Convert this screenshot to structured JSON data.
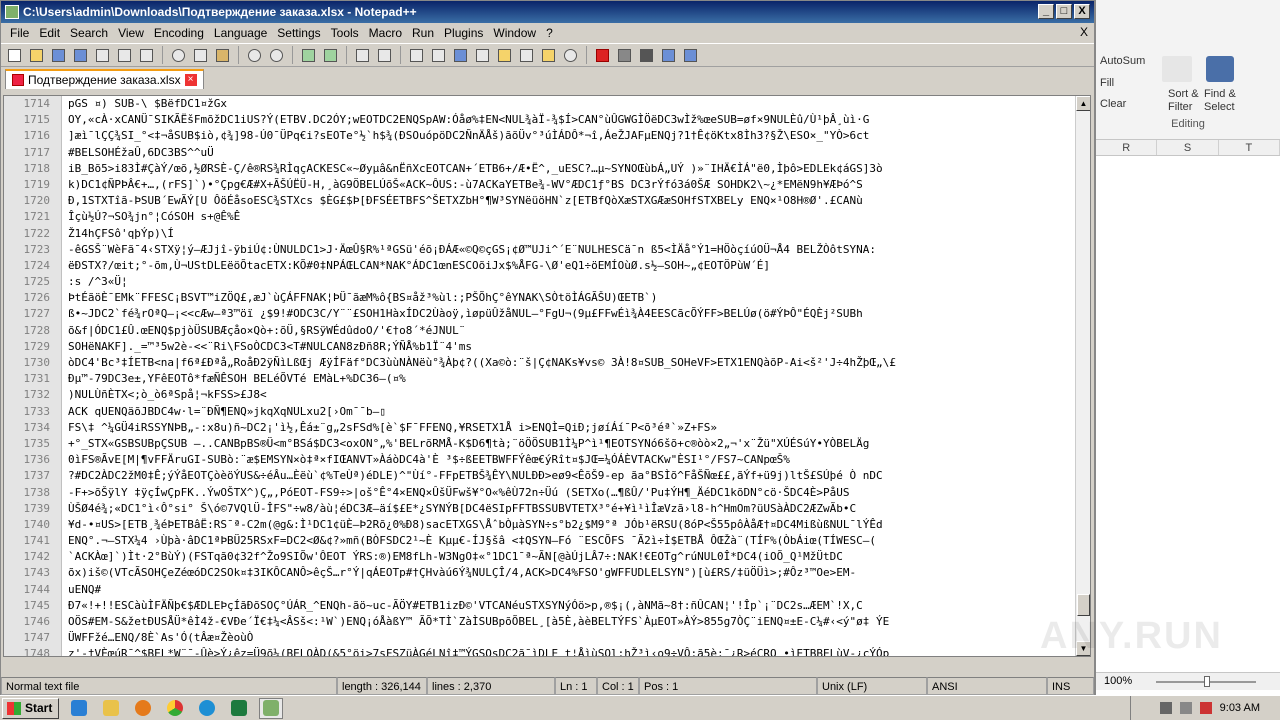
{
  "window": {
    "title": "C:\\Users\\admin\\Downloads\\Подтверждение заказа.xlsx - Notepad++",
    "min": "_",
    "max": "□",
    "close": "X"
  },
  "menu": [
    "File",
    "Edit",
    "Search",
    "View",
    "Encoding",
    "Language",
    "Settings",
    "Tools",
    "Macro",
    "Run",
    "Plugins",
    "Window",
    "?"
  ],
  "menu_close": "X",
  "tab": {
    "label": "Подтверждение заказа.xlsx",
    "close": "×"
  },
  "editor_lines": [
    {
      "n": "1714",
      "t": "pGS ¤) SUB-\\ $BëfDC1¤žGx"
    },
    {
      "n": "1715",
      "t": "OY,«cÀ·xCANÜ¯SIKÃËšFmõžDC1iUS?Ý(ETBV.DC2ÓY;wEOTDC2ENQSpAW:Óåø%‡EN<NUL¾àÏ-¾$Í>CAN°ùÛGWGÌÖëDC3wÌž%œeSUB=øf×9NULÈû/Ù¹þÂ¸ùì·G"
    },
    {
      "n": "1716",
      "t": "]æì¯lÇÇ¾SI_°<‡¬åSUB$iò,¢¾]98-Ú0¯ÜPq€i?sEOTe°½`h$¾(ÐSOuópöDC2ÑnÄÅš)ãõÜv°³úÌÁDÔ*¬î,ÁeŽJAFµENQj?1†Ê¢öKtx8Ìh3?§Ž\\ESO×_\"YÒ>6ct"
    },
    {
      "n": "1717",
      "t": "#BELSOHÉžaÛ,6DC3BS^^uÜ"
    },
    {
      "n": "1718",
      "t": "iB_Bõ5>i83Ì#ÇàÝ/œõ,½ØRSÈ-Ç/ê®RS¾RÌqçACKESC«~Øyµâ&nËñXcEOTCAN+´ETB6+/Æ•Ë^,_uESC?…µ~SYNOŒùbÁ„UÝ )»¨IHÄ€ÌÁ\"ë0,Ìþô>EDLEk¢áGS]3ò"
    },
    {
      "n": "1719",
      "t": "k)DC1¢ÑPÞÂ€+…,(rFS]`)•°Çpg€Æ#X+ÃŠÚËÜ-H,¸àG9ÖBELÚõŠ«ACK~ÔUS:-ù7ACKaYETBe¾-WV°ÆDC1ƒ°BS DC3rÝfó3á0ŠÆ SOHDK2\\~¿*EMëN9h¥ÆÞó^S"
    },
    {
      "n": "1720",
      "t": "Ð,1STXTîã-ÞSUB´EwÃÝ[U ÔöÉåsoESC¾STXcs $ÈG£$Þ[ÐFSÉETBFS^ŠETXZbH°¶W³SYNëüöHN`z[ETBfQòXæSTXGÆæSOHfSTXBELy ENQ×¹O8H®Ø'.£CANù"
    },
    {
      "n": "1721",
      "t": "Îçù½Ú?¬SO¾jn°¦CóSOH s+@Ê%Ê"
    },
    {
      "n": "1722",
      "t": "Ž14hÇFSô'qþÝp)\\Í"
    },
    {
      "n": "1723",
      "t": "-êGSŠ¨WèFã¯4‹STXÿ¦ý—ÆJjî-ÿbiÚ¢:ÙNULDC1>J·ÄœÛ§R%¹ªGSü'éõ¡ÐÁÆ«©Q©çGS¡¢Ø™UJi^´E¨NULHESCä¯n ß5<ÌÄå°Ý1=HÖòçíúOÜ¬Å4 BELŽÒôtSYNA:"
    },
    {
      "n": "1724",
      "t": "ëÐSTX?/œit;°-õm,Ù¬UStDLEëöÕtacETX:KÕ#0‡NPÁŒLCAN*NAK°ÁDC1œnESCOõiJx$%ÅFG-\\Ø'eQ1÷öEMÍOùØ.s½—SOH~„¢EOTÖPùW´É]"
    },
    {
      "n": "1725",
      "t": ":s  /^3«Ü¦"
    },
    {
      "n": "1726",
      "t": "ÞtÉãöÈ¯EMk¨FFESC¡BSVT™iZÖQ£,æJ`ùÇÁFFNAK¦ÞÜ¯ãæM%ô{BS¤åž³%ùl:;PŠÕhÇ°êYNAK\\SÒtöÌÁGÃŠU)ŒETB`)"
    },
    {
      "n": "1727",
      "t": " ß•~JDC2`fé¾rOªQ—¡<<cÆw—ª3™öï  ¿$9!#ODC3C/Y¨¨£SOH1HàxÍDC2Ùàoÿ,ìøpüÛžåNUL—°FgU¬(9µ£FFwÉì¾À4EESCãcÕÝFF>BELÚø(ö#ÝÞÔ\"ÉQÈj²SUBh"
    },
    {
      "n": "1728",
      "t": "õ&f|ÓDC1£Û.œENQ$pjòÜSUBÆçåo×Qò+:õÜ,§RSÿWÉdûdoO/'€†o8´*éJNUL¨"
    },
    {
      "n": "1729",
      "t": "SOHëNAKF]._=™³5w2è-<<¨Ri\\FSoÒCDC3<T#NULCAN8zÐñ8R;ÝÑÅ%b1Ï¨4'ms"
    },
    {
      "n": "1730",
      "t": "òDC4'Bc³‡ÍETB<na|f6ª£Ðªå„RoåÐ2ÿÑìLßŒj ÆÿÍFäf°DC3ùùNÀNëù°¾Àþ¢?((Xa©ò:¨š|Ç¢NAKs¥vs© 3À!8¤SUB_SOHeVF>ETX1ENQàõP-Ai<š²'J÷4hŽþŒ„\\£"
    },
    {
      "n": "1731",
      "t": "Ðµ™-79DC3e±,YFêEOTô*fæÑÊSOH BELéÕVTé EMàL+%DC36—(¤%"
    },
    {
      "n": "1732",
      "t": ")NULÙñÈTX<;ò_ò6ªSpå¦¬kFSS>£J8<"
    },
    {
      "n": "1733",
      "t": "ACK qUENQäõJBDC4w·l=¨ÐÑ¶ENQ»jkqXqNULxu2[›Om¯¯b—▯"
    },
    {
      "n": "1734",
      "t": "FS\\‡ ^¼GÜ4iRSSYNÞB„-:x8u)ñ~DC2¡'ì½,Êá±¨g„2sFSd%[è`$F¯FFENQ,¥RSETX1Å    i>ENQÌ=QiÐ;jøíÁí¯P<õ³éª`»Z+FS»"
    },
    {
      "n": "1735",
      "t": "+°_STX«GSBSUBpÇSUB —..CANBpBS®Ü<m°BSá$DC3<oxON°„%'BELrõRMÅ-K$D6¶tà;¨öÖÖSUB1Ì¼P^ì¹¶EOTSYNó6šõ+c®òò×2„¬'x¨Žü\"XÚÉSúY•YÒBELÄg"
    },
    {
      "n": "1736",
      "t": "0ìFS®ÃvE[M|¶vFFÄruGI-SUBò:¨æ$EMSYN×ò‡ª×fIŒANVT»ÀáòDC4à'È    ³$÷ßEETBWFFÝêœ€ýRît¤$JŒ=¼ÓÁÈVTACKw\"ÈSI¹°/FS7~CANpœŠ%"
    },
    {
      "n": "1737",
      "t": "?#DC2ÀDC2žM0‡Ê;ýÝåEOTÇòèöÝUS&÷éÂu…Èëù`¢%TeÙª)éDLE)^\"Ùí°-FFpETBŠ¾ÊY\\NULÐÐ>eø9<ÊõŠ9-ep ãa°BSÌõ^FåŠÑœ££,ãÝf+ü9j)ltŠ£SÚþé Ò nDC"
    },
    {
      "n": "1738",
      "t": " -F+>õŠÿlY  ‡ÿçÍwÇpFK..ÝwOŠTX^)Ç„,PóEOT-FS9÷>|oš°Ê°4×ENQ×ÛšÜFwš¥°O«%êÙ72n÷Üú (SETXo(…¶ßÛ/'Pu‡ÝH¶_ÄéDC1kõDN°cö·ŠDC4È>PåUS"
    },
    {
      "n": "1739",
      "t": "ÙŠØ4é¾;«DC1°ì‹Ô°si° Š\\ó©7VQlÜ-ÎFS\"÷w8/àù¦éDC3Æ—äí$£E*¿SYNÝB[DC4ëSIpFFTBSSUBVTETX³°é+¥ì¹ìÎæVzã›l8-h^HmOm?üUSàÀDC2ÆZwÃb•C"
    },
    {
      "n": "1740",
      "t": "¥d-•¤US>[ETB¸¾éÞETBâË:RS¯ª-C2m(@g&:Ì¹DC1¢üÈ—Þ2Rõ¿0%Ð8)sacETXGS\\ÅˆbÒµàSYN÷s°b2¿$M9°ª JÓb¹ëRSU(8óP<Š55pôÀåÆ†¤DC4MißùßNUL¯lÝÊd"
    },
    {
      "n": "1741",
      "t": "ENQ°.¬—STX¼4 ›Ùþà·âDC1ªÞBÜ25RSxF=DC2<Ø&¢?»mñ(BÒFSDC2¹~È Kµµ€-ÍJ§šâ <‡QSYN—Fó ¨ESCÕFS ¯Ã2ì÷Ì$ETBÅ ÔŒŽà¨(TÍF%(ÒbÁiœ(TÍWESC—("
    },
    {
      "n": "1742",
      "t": "`ACKÀœ]`)Ìt·2°BùÝ)(FSTqã0¢32f^Žo9SIÕw'ÔEOT     ÝRS:®)EM8fLh-W3NgO‡«°1DC1¯ª~ÃN[@àÚjLÂ7÷:NAK!€EOTg^rúNUL0Î*DC4(iOÕ_Q¹MžÜtDC"
    },
    {
      "n": "1743",
      "t": "õx)iš©(VTcÃSOHÇeZéœóDC2SOk¤‡3IKÔCANÔ>êçŠ…r°Ý|qÁEOTp#†ÇHvàú6Ý¾NULÇÎ/4,ACK>DC4%FSO'gWFFUDLELSYN°)[ù£RS/‡üÖÜì>;#Ôz³™Oe>EM-"
    },
    {
      "n": "1744",
      "t": "uENQ#"
    },
    {
      "n": "1745",
      "t": "Ð7«!+!!ESCàùÌFÄÑþ€$ÆDLEÞçÍãÐõSOÇ°ÚÁR_^ENQh-ãö~uc-ÃÖY#ETB1izÐ©'VTCANéuSTXSYNýÓö>p,®$¡(,àNMã~8†:ñÛCAN¦'!Îp`¡¨DC2s…ÆEM`!X,C"
    },
    {
      "n": "1746",
      "t": "OÖS#EM-S&žetÐUSÅÜ*êÌ4ž-€VÐe´Ï€‡¼<ÂSš<:¹W`)ENQ¡óÅàßY™ ÃÕ*TÌ`ZàÌSUBpõÕBEL¸[à5È,àèBELTÝFS`ÀµEOT»ÀÝ>855g7ÒÇ¨iENQ¤±E-C¼#‹<ý\"ø‡ ÝE"
    },
    {
      "n": "1747",
      "t": "ÜWFFžé…ENQ/8È`As'Ó(tÂæ¤ŽèoùÒ"
    },
    {
      "n": "1748",
      "t": "z'-†VÈœúR¯^$BEL*W¨¯-Ûè>Ý¿êz=Ü9õ¼(BELOÀD(&5°öi>7sFSZüÀGéLNî‡™ÝGSOsDC2ã¯ìDLE_t¦ÅìùSOl:hŽ³ì‹o9÷VÔ;ã5è;¯¿R>éÇRQ_•ìETBBELùV-¿çÝÓp"
    }
  ],
  "status": {
    "type": "Normal text file",
    "length": "length : 326,144",
    "lines": "lines : 2,370",
    "ln": "Ln : 1",
    "col": "Col : 1",
    "pos": "Pos : 1",
    "eol": "Unix (LF)",
    "encoding": "ANSI",
    "ins": "INS"
  },
  "excel": {
    "autosum": "AutoSum",
    "fill": "Fill",
    "clear": "Clear",
    "sort": "Sort &",
    "filter": "Filter",
    "find": "Find &",
    "select": "Select",
    "group": "Editing",
    "cols": [
      "R",
      "S",
      "T"
    ],
    "zoom": "100%"
  },
  "taskbar": {
    "start": "Start",
    "time": "9:03 AM"
  },
  "watermark": "ANY.RUN"
}
